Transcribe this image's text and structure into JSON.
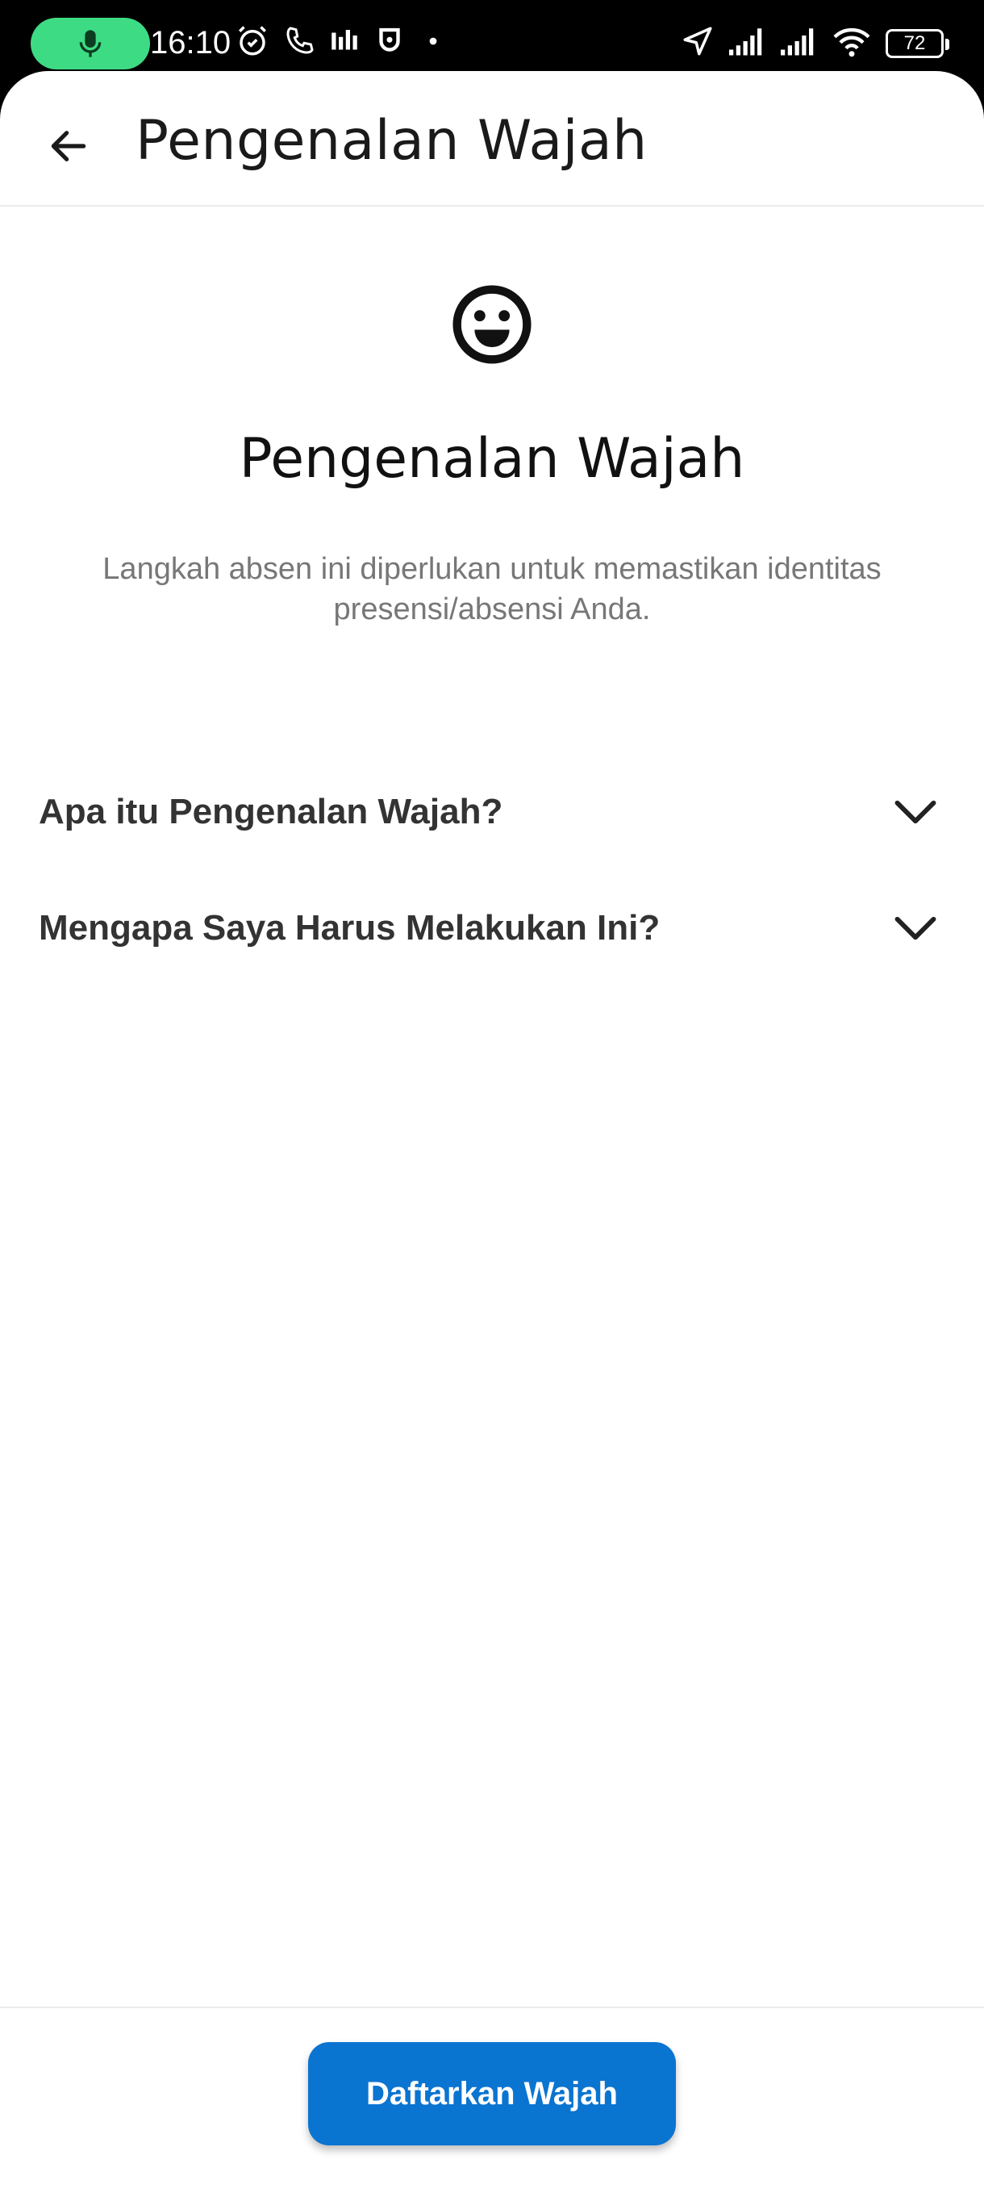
{
  "status_bar": {
    "time": "16:10",
    "battery": "72",
    "icons": [
      "mic-icon",
      "alarm-icon",
      "phone-icon",
      "equalizer-icon",
      "notification-app-icon",
      "dot-icon",
      "location-arrow-icon",
      "signal-icon",
      "signal-icon",
      "wifi-icon",
      "battery-icon"
    ],
    "mic_color": "#3ddc84"
  },
  "app_bar": {
    "title": "Pengenalan Wajah",
    "back_icon": "arrow-left-icon"
  },
  "content": {
    "icon": "smiley-face-icon",
    "heading": "Pengenalan Wajah",
    "description": "Langkah absen ini diperlukan untuk memastikan identitas presensi/absensi Anda."
  },
  "faq": [
    {
      "question": "Apa itu Pengenalan Wajah?",
      "icon": "chevron-down-icon"
    },
    {
      "question": "Mengapa Saya Harus Melakukan Ini?",
      "icon": "chevron-down-icon"
    }
  ],
  "footer": {
    "button_label": "Daftarkan Wajah",
    "button_color": "#0a74d1"
  }
}
